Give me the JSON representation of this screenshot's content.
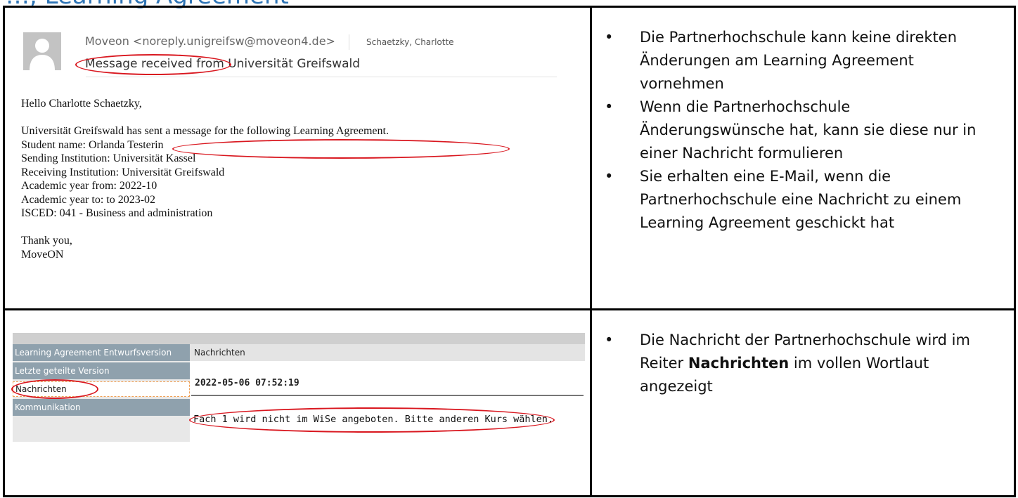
{
  "page": {
    "title": "…, Learning Agreement"
  },
  "email": {
    "from": "Moveon <noreply.unigreifsw@moveon4.de>",
    "to": "Schaetzky, Charlotte",
    "subject": "Message received from Universität Greifswald",
    "greeting": "Hello Charlotte Schaetzky,",
    "body_lines": [
      "Universität Greifswald has sent a message for the following Learning Agreement.",
      "Student name: Orlanda Testerin",
      "Sending Institution: Universität Kassel",
      "Receiving Institution: Universität Greifswald",
      "Academic year from: 2022-10",
      "Academic year to: to 2023-02",
      "ISCED: 041 - Business and administration"
    ],
    "closing": "Thank you,",
    "signature": "MoveON"
  },
  "bullets_top": [
    "Die Partnerhochschule kann keine direkten Änderungen am Learning Agreement vornehmen",
    "Wenn die Partnerhochschule Änderungswünsche hat, kann sie diese nur in einer Nachricht formulieren",
    "Sie erhalten eine E-Mail, wenn die Partnerhochschule eine Nachricht zu einem Learning Agreement geschickt hat"
  ],
  "app": {
    "nav_items": [
      "Learning Agreement Entwurfsversion",
      "Letzte geteilte Version",
      "Nachrichten",
      "Kommunikation"
    ],
    "content_header": "Nachrichten",
    "message_date": "2022-05-06 07:52:19",
    "message_text": "Fach 1 wird nicht im WiSe angeboten. Bitte anderen Kurs wählen."
  },
  "bullet_bottom": {
    "before": "Die Nachricht der Partnerhochschule wird im Reiter ",
    "bold": "Nachrichten",
    "after": " im vollen Wortlaut angezeigt"
  },
  "colors": {
    "annotation_red": "#d9171f",
    "nav_gray": "#8fa1ad",
    "title_blue": "#2e74b5"
  }
}
